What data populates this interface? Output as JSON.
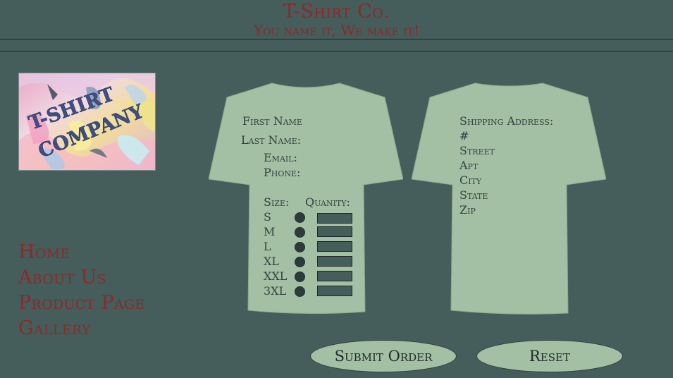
{
  "header": {
    "title": "T-Shirt Co.",
    "tagline": "You name it, We make it!"
  },
  "logo": {
    "line1": "T-SHIRT",
    "line2": "COMPANY"
  },
  "nav": {
    "items": [
      "Home",
      "About Us",
      "Product Page",
      "Gallery"
    ]
  },
  "order_form": {
    "first_name": "First Name",
    "last_name": "Last Name:",
    "email": "Email:",
    "phone": "Phone:",
    "size_header": "Size:",
    "quantity_header": "Quanity:",
    "sizes": [
      "S",
      "M",
      "L",
      "XL",
      "XXL",
      "3XL"
    ]
  },
  "shipping": {
    "heading": "Shipping Address:",
    "fields": [
      "#",
      "Street",
      "Apt",
      "City",
      "State",
      "Zip"
    ]
  },
  "buttons": {
    "submit": "Submit Order",
    "reset": "Reset"
  },
  "colors": {
    "background": "#455d5b",
    "accent": "#8a2a2a",
    "shirt": "#a3bfa4",
    "text": "#33413f"
  }
}
